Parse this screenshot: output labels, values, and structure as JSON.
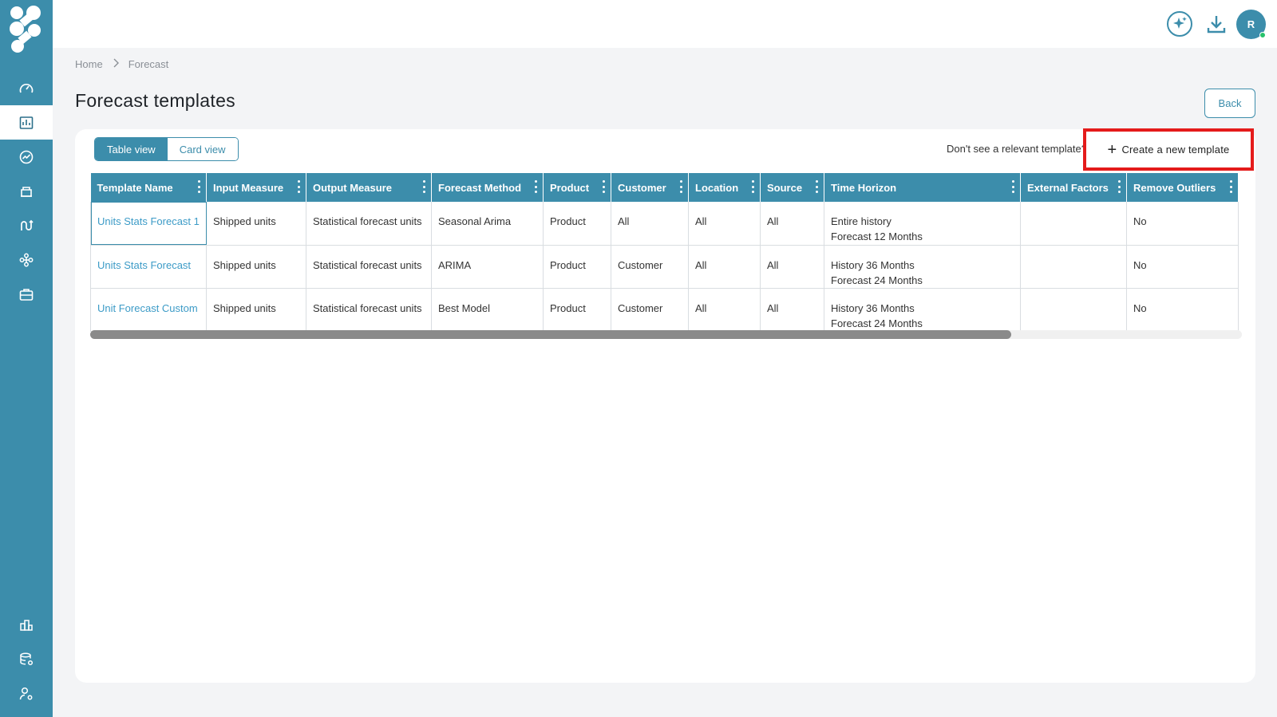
{
  "topbar": {
    "icons": [
      "ai-sparkle-icon",
      "download-icon"
    ],
    "avatar_initial": "R",
    "online_status_color": "#27c26c"
  },
  "sidebar": {
    "accent_color": "#3c8dab",
    "items": [
      {
        "icon": "dashboard-gauge-icon",
        "active": false
      },
      {
        "icon": "forecast-chart-icon",
        "active": true
      },
      {
        "icon": "analytics-icon",
        "active": false
      },
      {
        "icon": "inventory-icon",
        "active": false
      },
      {
        "icon": "flow-icon",
        "active": false
      },
      {
        "icon": "network-icon",
        "active": false
      },
      {
        "icon": "briefcase-icon",
        "active": false
      },
      {
        "icon": "reports-icon",
        "active": false
      },
      {
        "icon": "database-settings-icon",
        "active": false
      },
      {
        "icon": "user-settings-icon",
        "active": false
      }
    ]
  },
  "breadcrumb": {
    "home": "Home",
    "current": "Forecast"
  },
  "page": {
    "title": "Forecast templates",
    "back_label": "Back"
  },
  "view_toggle": {
    "table": "Table view",
    "card": "Card view",
    "selected": "Table view"
  },
  "hint_text": "Don't see a relevant template?",
  "create_label": "Create a new template",
  "table": {
    "columns": [
      "Template Name",
      "Input Measure",
      "Output Measure",
      "Forecast Method",
      "Product",
      "Customer",
      "Location",
      "Source",
      "Time Horizon",
      "External Factors",
      "Remove Outliers"
    ],
    "rows": [
      {
        "name": "Units Stats Forecast 1",
        "input": "Shipped units",
        "output": "Statistical forecast units",
        "method": "Seasonal Arima",
        "product": "Product",
        "customer": "All",
        "location": "All",
        "source": "All",
        "horizon_1": "Entire history",
        "horizon_2": "Forecast 12 Months",
        "external": "",
        "outliers": "No"
      },
      {
        "name": "Units Stats Forecast",
        "input": "Shipped units",
        "output": "Statistical forecast units",
        "method": "ARIMA",
        "product": "Product",
        "customer": "Customer",
        "location": "All",
        "source": "All",
        "horizon_1": "History 36 Months",
        "horizon_2": "Forecast 24 Months",
        "external": "",
        "outliers": "No"
      },
      {
        "name": "Unit Forecast Custom",
        "input": "Shipped units",
        "output": "Statistical forecast units",
        "method": "Best Model",
        "product": "Product",
        "customer": "Customer",
        "location": "All",
        "source": "All",
        "horizon_1": "History 36 Months",
        "horizon_2": "Forecast 24 Months",
        "external": "",
        "outliers": "No"
      }
    ]
  },
  "scrollbar": {
    "visible_fraction": 0.8
  }
}
